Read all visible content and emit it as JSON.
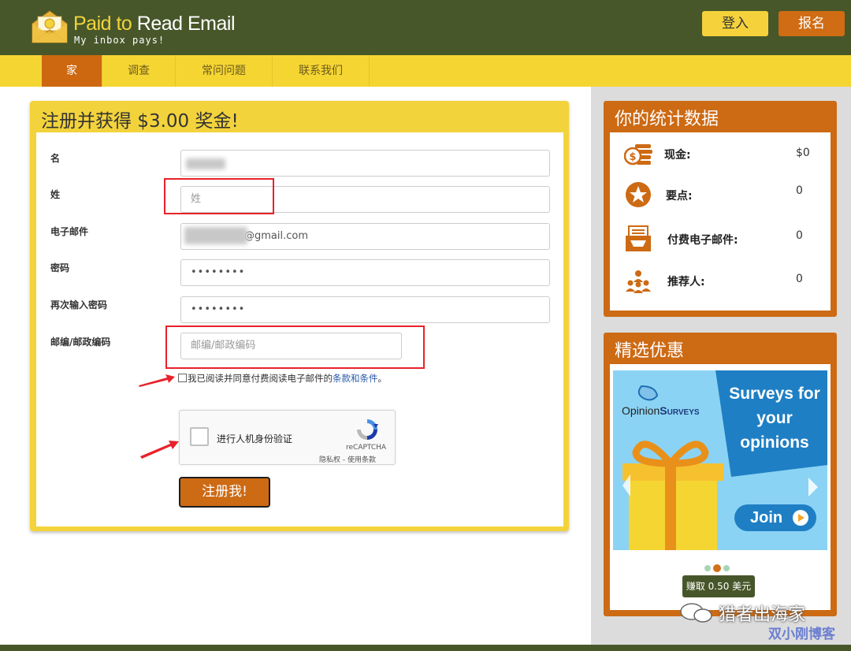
{
  "brand": {
    "title_part1": "Paid to ",
    "title_part2": "Read Email",
    "tagline": "My inbox pays!"
  },
  "header": {
    "login_label": "登入",
    "signup_label": "报名"
  },
  "nav": {
    "items": [
      {
        "label": "家",
        "active": true
      },
      {
        "label": "调查",
        "active": false
      },
      {
        "label": "常问问题",
        "active": false
      },
      {
        "label": "联系我们",
        "active": false
      }
    ]
  },
  "form": {
    "title": "注册并获得 $3.00 奖金!",
    "fields": [
      {
        "label": "名",
        "value": "",
        "placeholder": ""
      },
      {
        "label": "姓",
        "value": "",
        "placeholder": "姓"
      },
      {
        "label": "电子邮件",
        "value": "@gmail.com",
        "placeholder": ""
      },
      {
        "label": "密码",
        "value": "••••••••",
        "placeholder": ""
      },
      {
        "label": "再次输入密码",
        "value": "••••••••",
        "placeholder": ""
      },
      {
        "label": "邮编/邮政编码",
        "value": "",
        "placeholder": "邮编/邮政编码"
      }
    ],
    "terms_text": "我已阅读并同意付费阅读电子邮件的",
    "terms_link": "条款和条件",
    "terms_end": "。",
    "captcha_text": "进行人机身份验证",
    "captcha_brand": "reCAPTCHA",
    "captcha_links": "隐私权 - 使用条款",
    "submit_label": "注册我!"
  },
  "stats": {
    "title": "你的统计数据",
    "rows": [
      {
        "icon": "cash-icon",
        "label": "现金:",
        "value": "$0"
      },
      {
        "icon": "star-icon",
        "label": "要点:",
        "value": "0"
      },
      {
        "icon": "inbox-icon",
        "label": "付费电子邮件:",
        "value": "0"
      },
      {
        "icon": "referrals-icon",
        "label": "推荐人:",
        "value": "0"
      }
    ]
  },
  "offers": {
    "title": "精选优惠",
    "banner": {
      "brand_part1": "Opinion",
      "brand_part2": "Surveys",
      "headline_line1": "Surveys for",
      "headline_line2": "your",
      "headline_line3": "opinions",
      "cta": "Join"
    },
    "earn_label": "赚取 0.50 美元"
  },
  "watermark": {
    "line1": "猎者出海家",
    "line2": "双小刚博客"
  },
  "colors": {
    "header_bg": "#47572a",
    "nav_bg": "#f5d532",
    "accent_orange": "#cd6a14",
    "accent_yellow": "#f3d33c",
    "annotation_red": "#e8222a"
  }
}
